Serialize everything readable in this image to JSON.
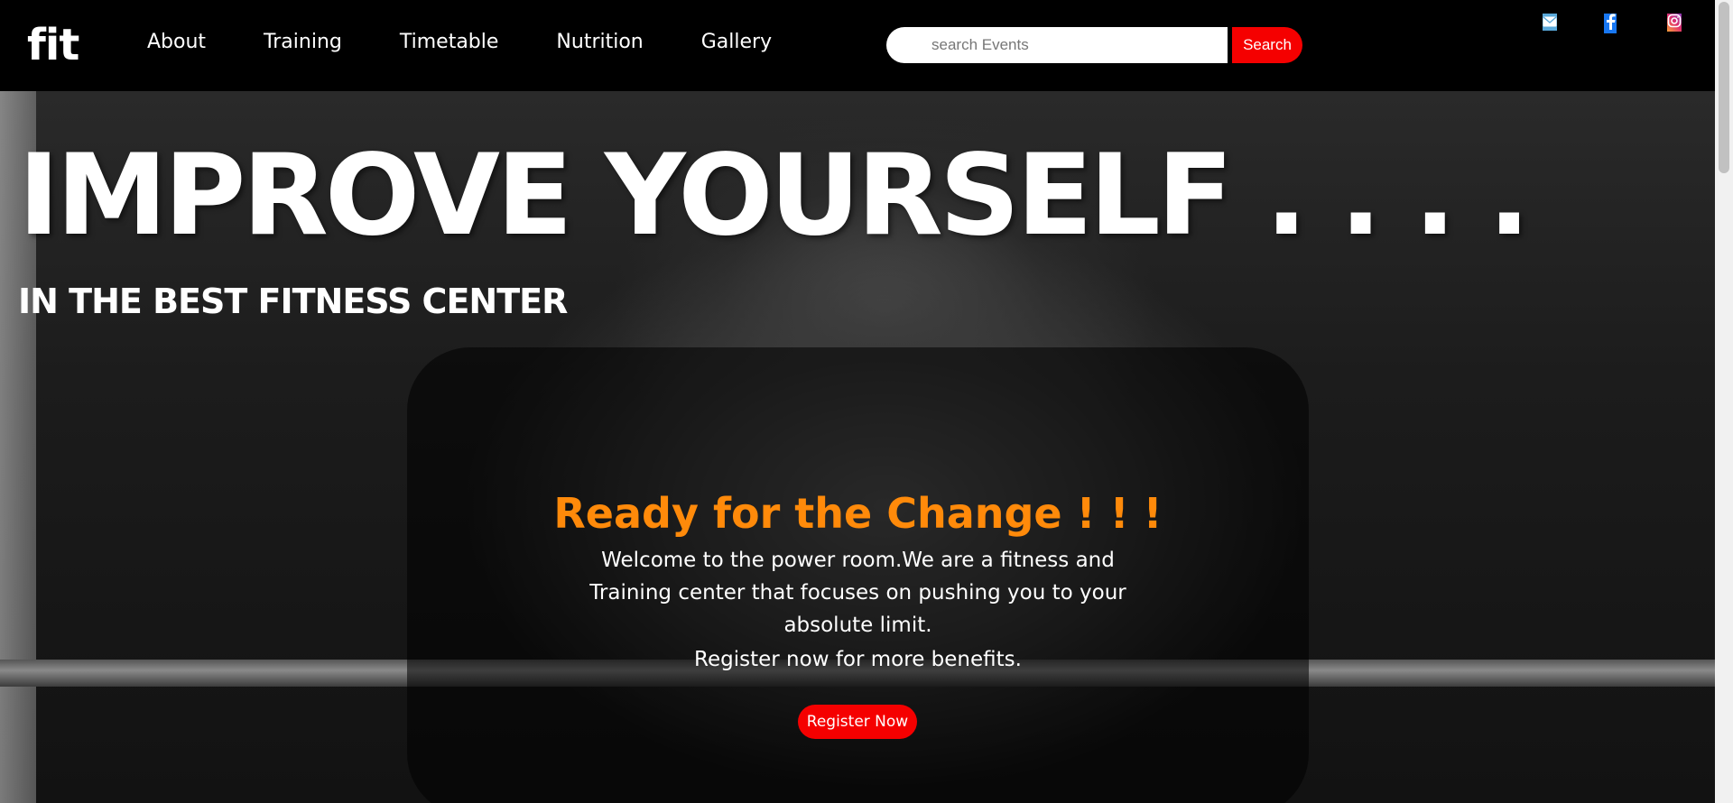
{
  "header": {
    "logo": "fit",
    "nav": [
      {
        "label": "About"
      },
      {
        "label": "Training"
      },
      {
        "label": "Timetable"
      },
      {
        "label": "Nutrition"
      },
      {
        "label": "Gallery"
      }
    ],
    "search": {
      "placeholder": "search Events",
      "button_label": "Search"
    },
    "social": [
      {
        "icon": "mail-icon",
        "color": "#5aa9da"
      },
      {
        "icon": "facebook-icon",
        "color": "#1877f2"
      },
      {
        "icon": "instagram-icon",
        "color": "#e1306c"
      }
    ]
  },
  "hero": {
    "title": "IMPROVE YOURSELF . . . .",
    "subtitle": "IN THE BEST FITNESS CENTER",
    "card": {
      "heading": "Ready for the Change ! ! !",
      "text": "Welcome to the power room.We are a fitness and Training center that focuses on pushing you to your absolute limit.",
      "note": "Register now for more benefits.",
      "button_label": "Register Now"
    }
  },
  "colors": {
    "accent_red": "#f50000",
    "heading_orange": "#ff8a0a",
    "background": "#000000"
  }
}
